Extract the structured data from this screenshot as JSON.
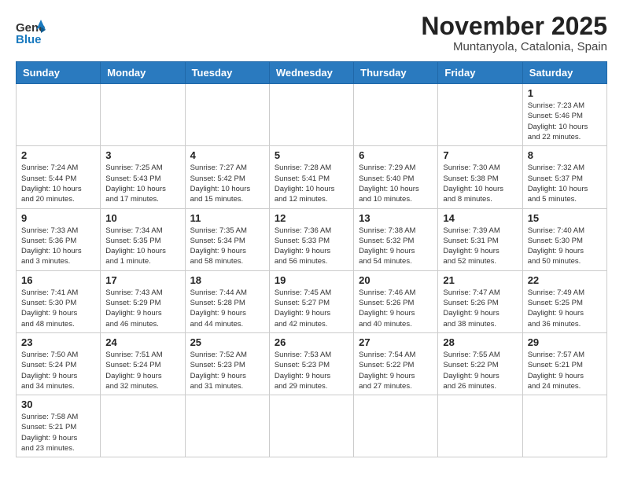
{
  "header": {
    "logo_general": "General",
    "logo_blue": "Blue",
    "month": "November 2025",
    "location": "Muntanyola, Catalonia, Spain"
  },
  "weekdays": [
    "Sunday",
    "Monday",
    "Tuesday",
    "Wednesday",
    "Thursday",
    "Friday",
    "Saturday"
  ],
  "weeks": [
    [
      {
        "day": "",
        "info": "",
        "empty": true
      },
      {
        "day": "",
        "info": "",
        "empty": true
      },
      {
        "day": "",
        "info": "",
        "empty": true
      },
      {
        "day": "",
        "info": "",
        "empty": true
      },
      {
        "day": "",
        "info": "",
        "empty": true
      },
      {
        "day": "",
        "info": "",
        "empty": true
      },
      {
        "day": "1",
        "info": "Sunrise: 7:23 AM\nSunset: 5:46 PM\nDaylight: 10 hours\nand 22 minutes."
      }
    ],
    [
      {
        "day": "2",
        "info": "Sunrise: 7:24 AM\nSunset: 5:44 PM\nDaylight: 10 hours\nand 20 minutes."
      },
      {
        "day": "3",
        "info": "Sunrise: 7:25 AM\nSunset: 5:43 PM\nDaylight: 10 hours\nand 17 minutes."
      },
      {
        "day": "4",
        "info": "Sunrise: 7:27 AM\nSunset: 5:42 PM\nDaylight: 10 hours\nand 15 minutes."
      },
      {
        "day": "5",
        "info": "Sunrise: 7:28 AM\nSunset: 5:41 PM\nDaylight: 10 hours\nand 12 minutes."
      },
      {
        "day": "6",
        "info": "Sunrise: 7:29 AM\nSunset: 5:40 PM\nDaylight: 10 hours\nand 10 minutes."
      },
      {
        "day": "7",
        "info": "Sunrise: 7:30 AM\nSunset: 5:38 PM\nDaylight: 10 hours\nand 8 minutes."
      },
      {
        "day": "8",
        "info": "Sunrise: 7:32 AM\nSunset: 5:37 PM\nDaylight: 10 hours\nand 5 minutes."
      }
    ],
    [
      {
        "day": "9",
        "info": "Sunrise: 7:33 AM\nSunset: 5:36 PM\nDaylight: 10 hours\nand 3 minutes."
      },
      {
        "day": "10",
        "info": "Sunrise: 7:34 AM\nSunset: 5:35 PM\nDaylight: 10 hours\nand 1 minute."
      },
      {
        "day": "11",
        "info": "Sunrise: 7:35 AM\nSunset: 5:34 PM\nDaylight: 9 hours\nand 58 minutes."
      },
      {
        "day": "12",
        "info": "Sunrise: 7:36 AM\nSunset: 5:33 PM\nDaylight: 9 hours\nand 56 minutes."
      },
      {
        "day": "13",
        "info": "Sunrise: 7:38 AM\nSunset: 5:32 PM\nDaylight: 9 hours\nand 54 minutes."
      },
      {
        "day": "14",
        "info": "Sunrise: 7:39 AM\nSunset: 5:31 PM\nDaylight: 9 hours\nand 52 minutes."
      },
      {
        "day": "15",
        "info": "Sunrise: 7:40 AM\nSunset: 5:30 PM\nDaylight: 9 hours\nand 50 minutes."
      }
    ],
    [
      {
        "day": "16",
        "info": "Sunrise: 7:41 AM\nSunset: 5:30 PM\nDaylight: 9 hours\nand 48 minutes."
      },
      {
        "day": "17",
        "info": "Sunrise: 7:43 AM\nSunset: 5:29 PM\nDaylight: 9 hours\nand 46 minutes."
      },
      {
        "day": "18",
        "info": "Sunrise: 7:44 AM\nSunset: 5:28 PM\nDaylight: 9 hours\nand 44 minutes."
      },
      {
        "day": "19",
        "info": "Sunrise: 7:45 AM\nSunset: 5:27 PM\nDaylight: 9 hours\nand 42 minutes."
      },
      {
        "day": "20",
        "info": "Sunrise: 7:46 AM\nSunset: 5:26 PM\nDaylight: 9 hours\nand 40 minutes."
      },
      {
        "day": "21",
        "info": "Sunrise: 7:47 AM\nSunset: 5:26 PM\nDaylight: 9 hours\nand 38 minutes."
      },
      {
        "day": "22",
        "info": "Sunrise: 7:49 AM\nSunset: 5:25 PM\nDaylight: 9 hours\nand 36 minutes."
      }
    ],
    [
      {
        "day": "23",
        "info": "Sunrise: 7:50 AM\nSunset: 5:24 PM\nDaylight: 9 hours\nand 34 minutes."
      },
      {
        "day": "24",
        "info": "Sunrise: 7:51 AM\nSunset: 5:24 PM\nDaylight: 9 hours\nand 32 minutes."
      },
      {
        "day": "25",
        "info": "Sunrise: 7:52 AM\nSunset: 5:23 PM\nDaylight: 9 hours\nand 31 minutes."
      },
      {
        "day": "26",
        "info": "Sunrise: 7:53 AM\nSunset: 5:23 PM\nDaylight: 9 hours\nand 29 minutes."
      },
      {
        "day": "27",
        "info": "Sunrise: 7:54 AM\nSunset: 5:22 PM\nDaylight: 9 hours\nand 27 minutes."
      },
      {
        "day": "28",
        "info": "Sunrise: 7:55 AM\nSunset: 5:22 PM\nDaylight: 9 hours\nand 26 minutes."
      },
      {
        "day": "29",
        "info": "Sunrise: 7:57 AM\nSunset: 5:21 PM\nDaylight: 9 hours\nand 24 minutes."
      }
    ],
    [
      {
        "day": "30",
        "info": "Sunrise: 7:58 AM\nSunset: 5:21 PM\nDaylight: 9 hours\nand 23 minutes."
      },
      {
        "day": "",
        "info": "",
        "empty": true
      },
      {
        "day": "",
        "info": "",
        "empty": true
      },
      {
        "day": "",
        "info": "",
        "empty": true
      },
      {
        "day": "",
        "info": "",
        "empty": true
      },
      {
        "day": "",
        "info": "",
        "empty": true
      },
      {
        "day": "",
        "info": "",
        "empty": true
      }
    ]
  ]
}
